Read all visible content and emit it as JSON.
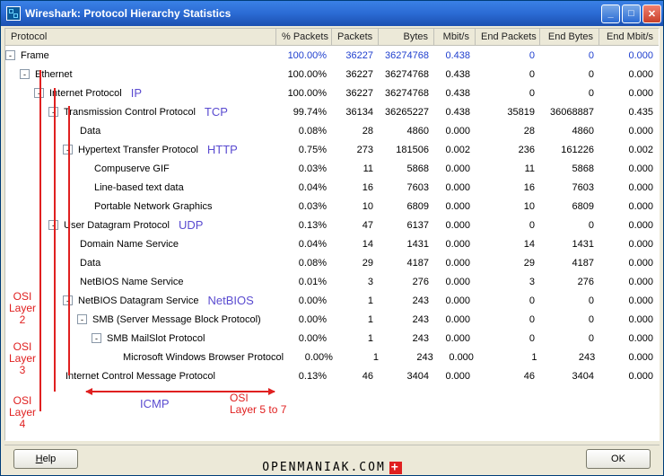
{
  "window": {
    "title": "Wireshark: Protocol Hierarchy Statistics"
  },
  "columns": {
    "protocol": "Protocol",
    "pct_packets": "% Packets",
    "packets": "Packets",
    "bytes": "Bytes",
    "mbits": "Mbit/s",
    "end_packets": "End Packets",
    "end_bytes": "End Bytes",
    "end_mbits": "End Mbit/s"
  },
  "rows": [
    {
      "depth": 0,
      "expand": "-",
      "label": "Frame",
      "annot": "",
      "pct": "100.00%",
      "pkts": "36227",
      "bytes": "36274768",
      "mbit": "0.438",
      "epkts": "0",
      "ebytes": "0",
      "embit": "0.000",
      "hl": true
    },
    {
      "depth": 1,
      "expand": "-",
      "label": "Ethernet",
      "annot": "",
      "pct": "100.00%",
      "pkts": "36227",
      "bytes": "36274768",
      "mbit": "0.438",
      "epkts": "0",
      "ebytes": "0",
      "embit": "0.000"
    },
    {
      "depth": 2,
      "expand": "-",
      "label": "Internet Protocol",
      "annot": "IP",
      "pct": "100.00%",
      "pkts": "36227",
      "bytes": "36274768",
      "mbit": "0.438",
      "epkts": "0",
      "ebytes": "0",
      "embit": "0.000"
    },
    {
      "depth": 3,
      "expand": "-",
      "label": "Transmission Control Protocol",
      "annot": "TCP",
      "pct": "99.74%",
      "pkts": "36134",
      "bytes": "36265227",
      "mbit": "0.438",
      "epkts": "35819",
      "ebytes": "36068887",
      "embit": "0.435"
    },
    {
      "depth": 4,
      "expand": "",
      "label": "Data",
      "annot": "",
      "pct": "0.08%",
      "pkts": "28",
      "bytes": "4860",
      "mbit": "0.000",
      "epkts": "28",
      "ebytes": "4860",
      "embit": "0.000"
    },
    {
      "depth": 4,
      "expand": "-",
      "label": "Hypertext Transfer Protocol",
      "annot": "HTTP",
      "pct": "0.75%",
      "pkts": "273",
      "bytes": "181506",
      "mbit": "0.002",
      "epkts": "236",
      "ebytes": "161226",
      "embit": "0.002"
    },
    {
      "depth": 5,
      "expand": "",
      "label": "Compuserve GIF",
      "annot": "",
      "pct": "0.03%",
      "pkts": "11",
      "bytes": "5868",
      "mbit": "0.000",
      "epkts": "11",
      "ebytes": "5868",
      "embit": "0.000"
    },
    {
      "depth": 5,
      "expand": "",
      "label": "Line-based text data",
      "annot": "",
      "pct": "0.04%",
      "pkts": "16",
      "bytes": "7603",
      "mbit": "0.000",
      "epkts": "16",
      "ebytes": "7603",
      "embit": "0.000"
    },
    {
      "depth": 5,
      "expand": "",
      "label": "Portable Network Graphics",
      "annot": "",
      "pct": "0.03%",
      "pkts": "10",
      "bytes": "6809",
      "mbit": "0.000",
      "epkts": "10",
      "ebytes": "6809",
      "embit": "0.000"
    },
    {
      "depth": 3,
      "expand": "-",
      "label": "User Datagram Protocol",
      "annot": "UDP",
      "pct": "0.13%",
      "pkts": "47",
      "bytes": "6137",
      "mbit": "0.000",
      "epkts": "0",
      "ebytes": "0",
      "embit": "0.000"
    },
    {
      "depth": 4,
      "expand": "",
      "label": "Domain Name Service",
      "annot": "",
      "pct": "0.04%",
      "pkts": "14",
      "bytes": "1431",
      "mbit": "0.000",
      "epkts": "14",
      "ebytes": "1431",
      "embit": "0.000"
    },
    {
      "depth": 4,
      "expand": "",
      "label": "Data",
      "annot": "",
      "pct": "0.08%",
      "pkts": "29",
      "bytes": "4187",
      "mbit": "0.000",
      "epkts": "29",
      "ebytes": "4187",
      "embit": "0.000"
    },
    {
      "depth": 4,
      "expand": "",
      "label": "NetBIOS Name Service",
      "annot": "",
      "pct": "0.01%",
      "pkts": "3",
      "bytes": "276",
      "mbit": "0.000",
      "epkts": "3",
      "ebytes": "276",
      "embit": "0.000"
    },
    {
      "depth": 4,
      "expand": "-",
      "label": "NetBIOS Datagram Service",
      "annot": "NetBIOS",
      "pct": "0.00%",
      "pkts": "1",
      "bytes": "243",
      "mbit": "0.000",
      "epkts": "0",
      "ebytes": "0",
      "embit": "0.000"
    },
    {
      "depth": 5,
      "expand": "-",
      "label": "SMB (Server Message Block Protocol)",
      "annot": "",
      "pct": "0.00%",
      "pkts": "1",
      "bytes": "243",
      "mbit": "0.000",
      "epkts": "0",
      "ebytes": "0",
      "embit": "0.000"
    },
    {
      "depth": 6,
      "expand": "-",
      "label": "SMB MailSlot Protocol",
      "annot": "",
      "pct": "0.00%",
      "pkts": "1",
      "bytes": "243",
      "mbit": "0.000",
      "epkts": "0",
      "ebytes": "0",
      "embit": "0.000"
    },
    {
      "depth": 7,
      "expand": "",
      "label": "Microsoft Windows Browser Protocol",
      "annot": "",
      "pct": "0.00%",
      "pkts": "1",
      "bytes": "243",
      "mbit": "0.000",
      "epkts": "1",
      "ebytes": "243",
      "embit": "0.000"
    },
    {
      "depth": 3,
      "expand": "",
      "label": "Internet Control Message Protocol",
      "annot": "",
      "pct": "0.13%",
      "pkts": "46",
      "bytes": "3404",
      "mbit": "0.000",
      "epkts": "46",
      "ebytes": "3404",
      "embit": "0.000"
    }
  ],
  "icmp_annot": "ICMP",
  "osi": {
    "l2": "OSI\nLayer\n2",
    "l3": "OSI\nLayer\n3",
    "l4": "OSI\nLayer\n4",
    "l57": "OSI\nLayer 5 to 7"
  },
  "buttons": {
    "help": "Help",
    "ok": "OK"
  },
  "watermark": "OPENMANIAK.COM"
}
